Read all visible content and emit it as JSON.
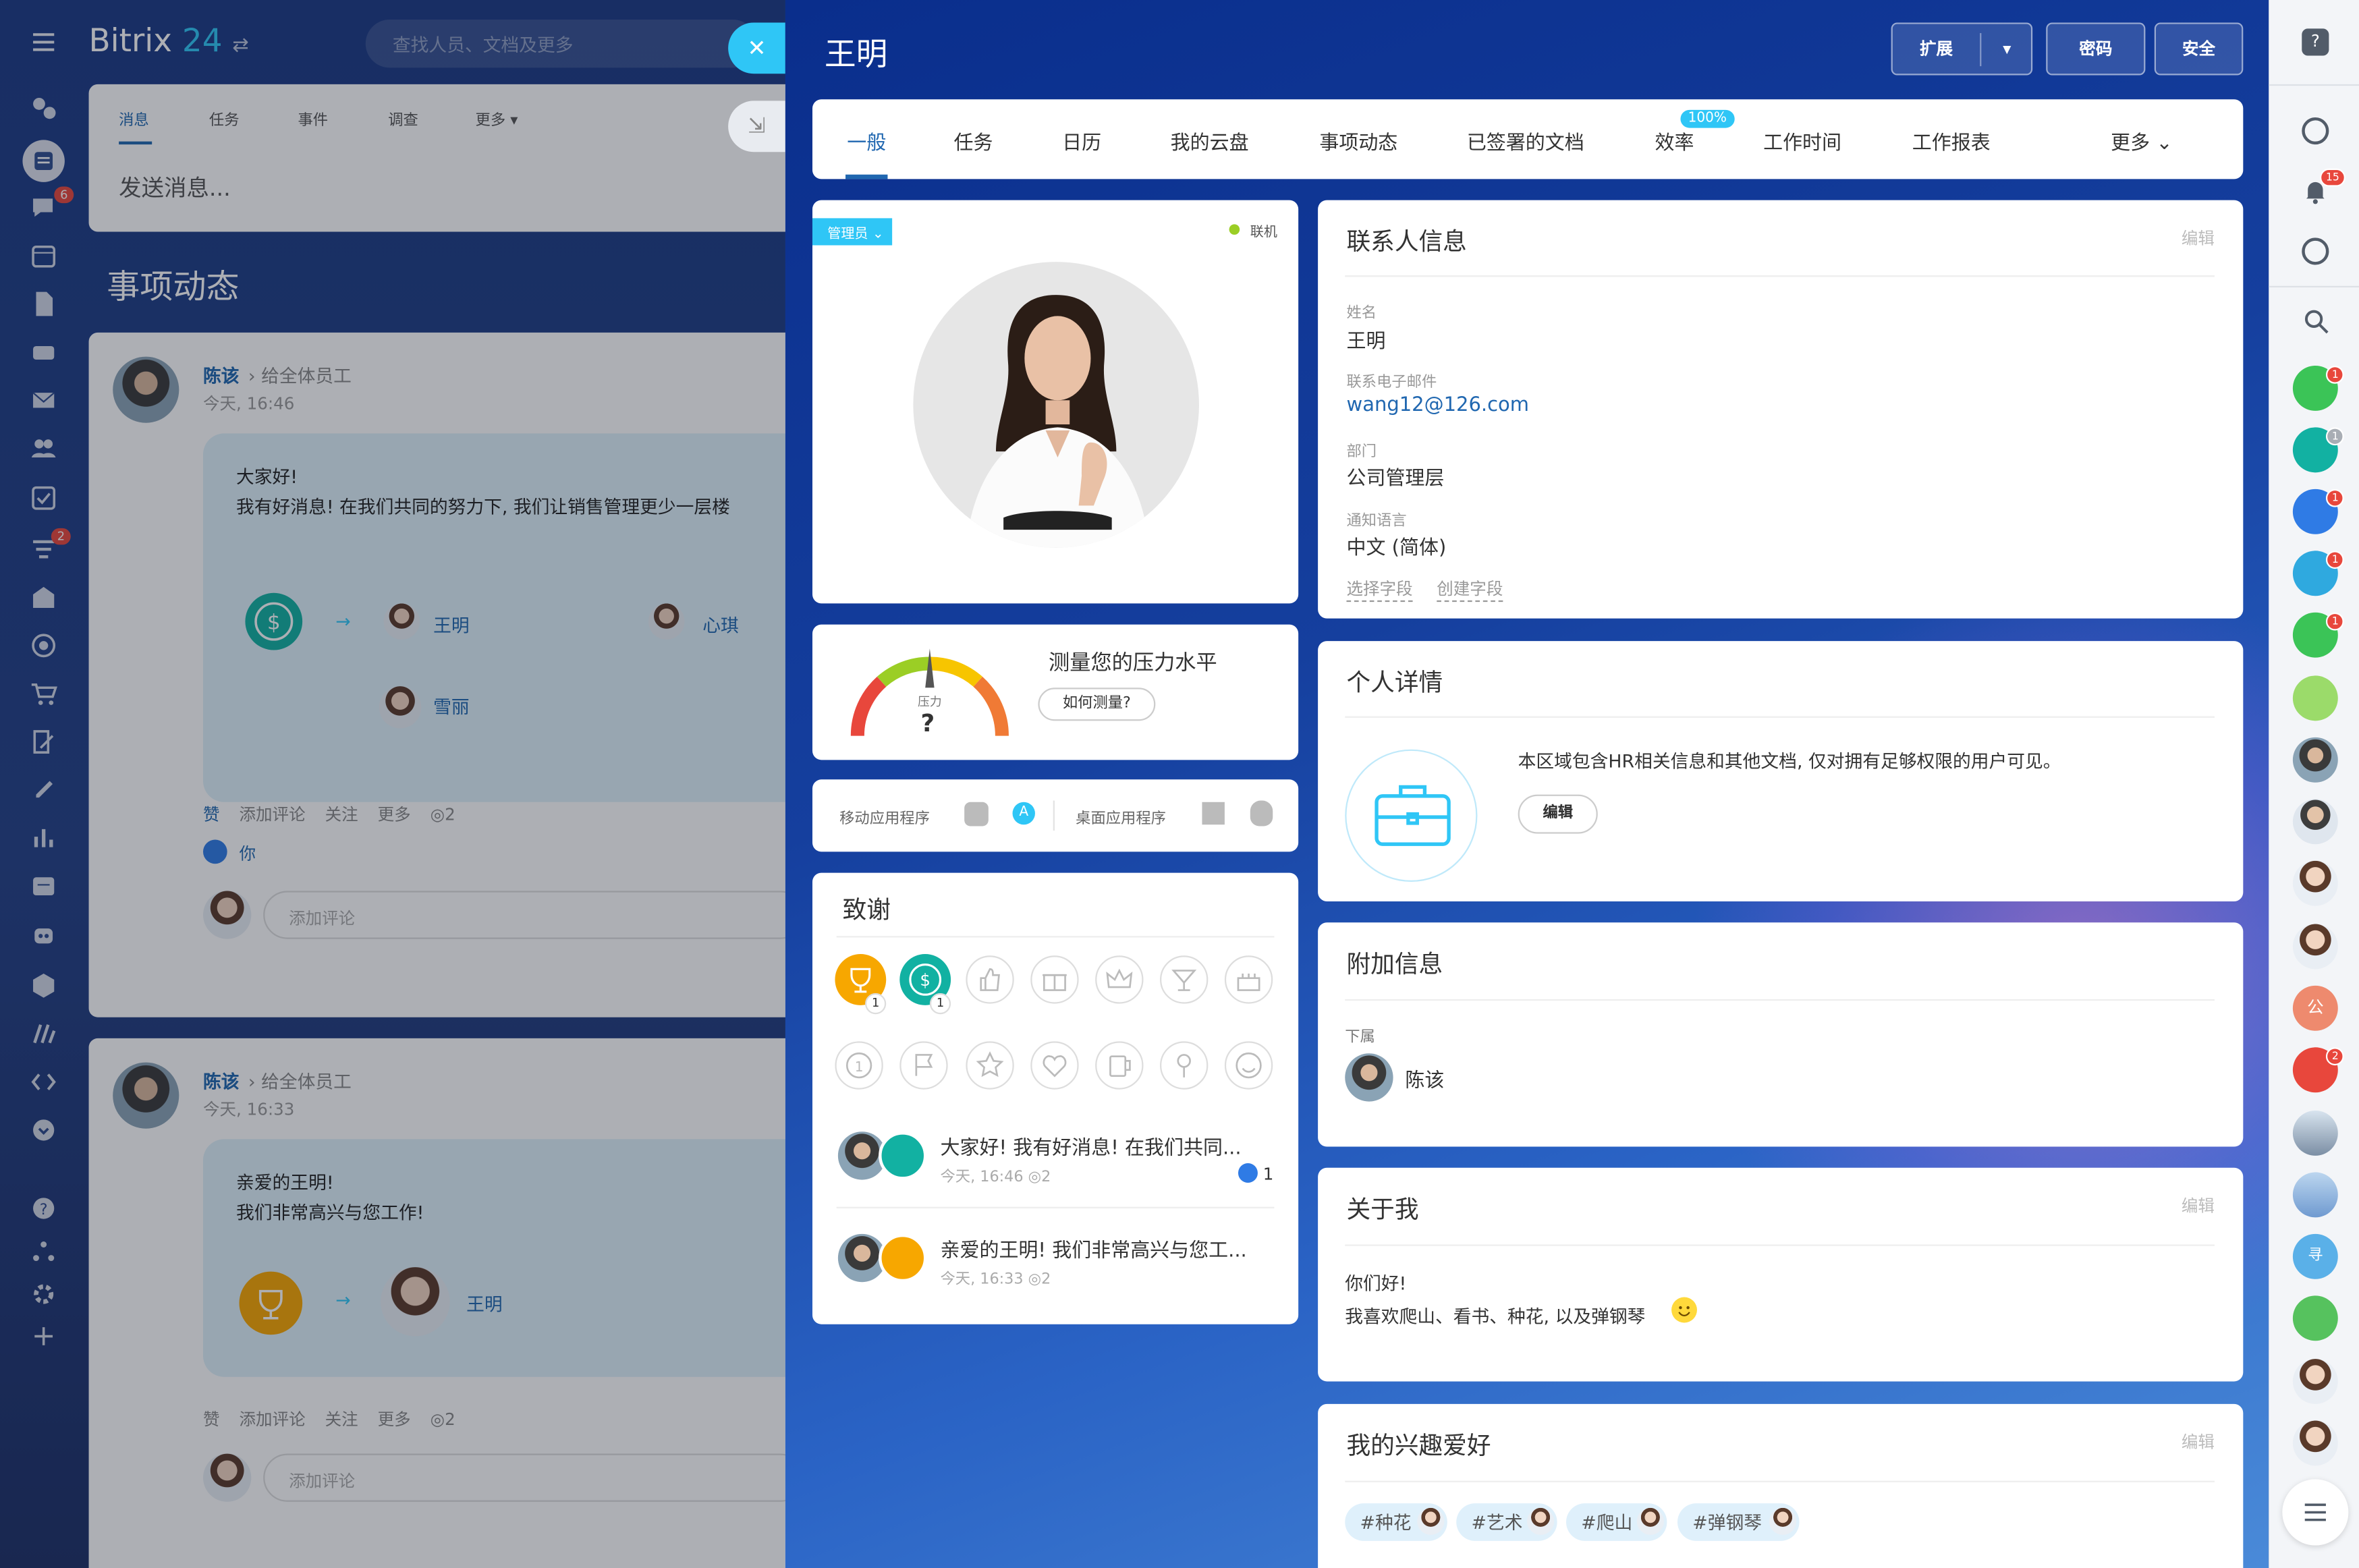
{
  "app": {
    "logo_word": "Bitrix",
    "logo_num": "24",
    "search_placeholder": "查找人员、文档及更多"
  },
  "left_nav": {
    "icons": [
      "activity-icon",
      "feed-icon",
      "chat-icon",
      "calendar-icon",
      "docs-icon",
      "drive-icon",
      "mail-icon",
      "groups-icon",
      "tasks-icon",
      "crm-icon",
      "sites-icon",
      "marketing-icon",
      "shop-icon",
      "sign-icon",
      "edit-icon",
      "analytics-icon",
      "company-icon",
      "robot-icon",
      "store-icon",
      "automation-icon",
      "developer-icon",
      "more-icon",
      "help-icon",
      "network-icon",
      "settings-icon",
      "add-icon"
    ],
    "badge_chat": "6",
    "badge_crm": "2"
  },
  "feed": {
    "tabs": [
      "消息",
      "任务",
      "事件",
      "调查",
      "更多"
    ],
    "post_placeholder": "发送消息...",
    "title": "事项动态",
    "posts": [
      {
        "author": "陈该",
        "to": "给全体员工",
        "time": "今天, 16:46",
        "line1": "大家好!",
        "line2": "我有好消息! 在我们共同的努力下, 我们让销售管理更少一层楼",
        "people": [
          "王明",
          "心琪",
          "雪丽"
        ],
        "actions": [
          "赞",
          "添加评论",
          "关注",
          "更多"
        ],
        "views": "2",
        "liked_by": "你",
        "comment_placeholder": "添加评论"
      },
      {
        "author": "陈该",
        "to": "给全体员工",
        "time": "今天, 16:33",
        "line1": "亲爱的王明!",
        "line2": "我们非常高兴与您工作!",
        "people": [
          "王明"
        ],
        "actions": [
          "赞",
          "添加评论",
          "关注",
          "更多"
        ],
        "views": "2",
        "comment_placeholder": "添加评论"
      }
    ]
  },
  "profile": {
    "name": "王明",
    "buttons": {
      "extend": "扩展",
      "password": "密码",
      "security": "安全"
    },
    "tabs": [
      "一般",
      "任务",
      "日历",
      "我的云盘",
      "事项动态",
      "已签署的文档",
      "效率",
      "工作时间",
      "工作报表",
      "更多"
    ],
    "efficiency_badge": "100%",
    "role_badge": "管理员",
    "status": "联机",
    "stress": {
      "title": "测量您的压力水平",
      "button": "如何测量?",
      "label": "压力",
      "value": "?"
    },
    "apps": {
      "mobile": "移动应用程序",
      "desktop": "桌面应用程序"
    },
    "thanks": {
      "title": "致谢",
      "badges_row1": [
        {
          "icon": "trophy-icon",
          "count": "1",
          "color": "#f7a700"
        },
        {
          "icon": "money-icon",
          "count": "1",
          "color": "#12b1a2"
        }
      ],
      "empty_row1": [
        "thumb-up-icon",
        "gift-icon",
        "crown-icon",
        "cocktail-icon",
        "cake-icon"
      ],
      "empty_row2": [
        "number-one-icon",
        "flag-icon",
        "star-icon",
        "heart-icon",
        "beer-icon",
        "flower-icon",
        "smile-icon"
      ],
      "items": [
        {
          "text": "大家好! 我有好消息! 在我们共同...",
          "time": "今天, 16:46",
          "views": "2",
          "likes": "1"
        },
        {
          "text": "亲爱的王明! 我们非常高兴与您工...",
          "time": "今天, 16:33",
          "views": "2"
        }
      ]
    },
    "contact": {
      "title": "联系人信息",
      "edit": "编辑",
      "fields": [
        {
          "label": "姓名",
          "value": "王明"
        },
        {
          "label": "联系电子邮件",
          "value": "wang12@126.com"
        },
        {
          "label": "部门",
          "value": "公司管理层"
        },
        {
          "label": "通知语言",
          "value": "中文 (简体)"
        }
      ],
      "links": [
        "选择字段",
        "创建字段"
      ]
    },
    "personal": {
      "title": "个人详情",
      "text": "本区域包含HR相关信息和其他文档, 仅对拥有足够权限的用户可见。",
      "button": "编辑"
    },
    "additional": {
      "title": "附加信息",
      "label": "下属",
      "person": "陈该"
    },
    "about": {
      "title": "关于我",
      "edit": "编辑",
      "line1": "你们好!",
      "line2": "我喜欢爬山、看书、种花, 以及弹钢琴"
    },
    "hobbies": {
      "title": "我的兴趣爱好",
      "edit": "编辑",
      "tags": [
        "#种花",
        "#艺术",
        "#爬山",
        "#弹钢琴"
      ]
    }
  },
  "right_side": {
    "bell_badge": "15",
    "group_badges": [
      "1",
      "1",
      "1",
      "1",
      "1"
    ],
    "company_label": "公",
    "chat_badge": "2",
    "user_initial": "寻"
  },
  "colors": {
    "accent": "#2fc6f6",
    "link": "#2067b0",
    "brand": "#0b2d8a",
    "green": "#3bc457",
    "red": "#e8473c"
  }
}
